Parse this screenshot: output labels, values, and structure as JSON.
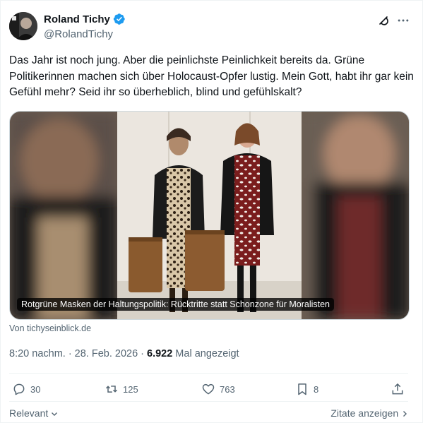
{
  "author": {
    "name": "Roland Tichy",
    "handle": "@RolandTichy",
    "verified": true,
    "verified_color": "#1d9bf0"
  },
  "tweet": {
    "text": "Das Jahr ist noch jung. Aber die peinlichste Peinlichkeit bereits da. Grüne Politikerinnen machen sich über Holocaust-Opfer lustig. Mein Gott, habt ihr gar kein Gefühl mehr? Seid ihr so überheblich, blind und gefühlskalt?"
  },
  "media": {
    "caption": "Rotgrüne Masken der Haltungspolitik: Rücktritte statt Schonzone für Moralisten",
    "source": "Von tichyseinblick.de"
  },
  "meta": {
    "time": "8:20 nachm.",
    "separator": "·",
    "date": "28. Feb. 2026",
    "views_count": "6.922",
    "views_label": "Mal angezeigt"
  },
  "actions": {
    "replies": "30",
    "reposts": "125",
    "likes": "763",
    "bookmarks": "8"
  },
  "footer": {
    "relevant_label": "Relevant",
    "quotes_label": "Zitate anzeigen"
  },
  "icons": {
    "verified": "verified-badge-icon",
    "grok": "grok-icon",
    "more": "more-icon",
    "reply": "reply-icon",
    "repost": "repost-icon",
    "like": "like-icon",
    "bookmark": "bookmark-icon",
    "share": "share-icon"
  }
}
